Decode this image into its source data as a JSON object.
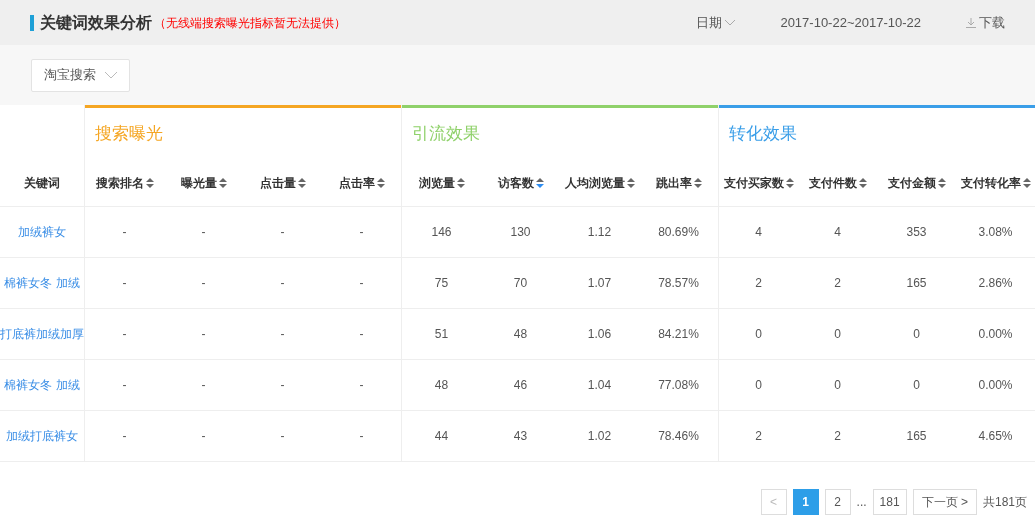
{
  "header": {
    "title": "关键词效果分析",
    "note": "（无线端搜索曝光指标暂无法提供）",
    "date_label": "日期",
    "date_range": "2017-10-22~2017-10-22",
    "download": "下载"
  },
  "source_select": {
    "value": "淘宝搜索"
  },
  "table": {
    "keyword_column": "关键词",
    "groups": [
      {
        "title": "搜索曝光",
        "color": "#f5a623",
        "columns": [
          {
            "label": "搜索排名",
            "sorted": false
          },
          {
            "label": "曝光量",
            "sorted": false
          },
          {
            "label": "点击量",
            "sorted": false
          },
          {
            "label": "点击率",
            "sorted": false
          }
        ]
      },
      {
        "title": "引流效果",
        "color": "#8fd16a",
        "columns": [
          {
            "label": "浏览量",
            "sorted": false
          },
          {
            "label": "访客数",
            "sorted": true
          },
          {
            "label": "人均浏览量",
            "sorted": false
          },
          {
            "label": "跳出率",
            "sorted": false
          }
        ]
      },
      {
        "title": "转化效果",
        "color": "#3a9ee8",
        "columns": [
          {
            "label": "支付买家数",
            "sorted": false
          },
          {
            "label": "支付件数",
            "sorted": false
          },
          {
            "label": "支付金额",
            "sorted": false
          },
          {
            "label": "支付转化率",
            "sorted": false
          }
        ]
      }
    ],
    "rows": [
      {
        "keyword": "加绒裤女",
        "cells": [
          "-",
          "-",
          "-",
          "-",
          "146",
          "130",
          "1.12",
          "80.69%",
          "4",
          "4",
          "353",
          "3.08%"
        ]
      },
      {
        "keyword": "棉裤女冬 加绒",
        "cells": [
          "-",
          "-",
          "-",
          "-",
          "75",
          "70",
          "1.07",
          "78.57%",
          "2",
          "2",
          "165",
          "2.86%"
        ]
      },
      {
        "keyword": "打底裤加绒加厚",
        "cells": [
          "-",
          "-",
          "-",
          "-",
          "51",
          "48",
          "1.06",
          "84.21%",
          "0",
          "0",
          "0",
          "0.00%"
        ]
      },
      {
        "keyword": "棉裤女冬 加绒",
        "cells": [
          "-",
          "-",
          "-",
          "-",
          "48",
          "46",
          "1.04",
          "77.08%",
          "0",
          "0",
          "0",
          "0.00%"
        ]
      },
      {
        "keyword": "加绒打底裤女",
        "cells": [
          "-",
          "-",
          "-",
          "-",
          "44",
          "43",
          "1.02",
          "78.46%",
          "2",
          "2",
          "165",
          "4.65%"
        ]
      }
    ]
  },
  "pagination": {
    "prev": "<",
    "pages": [
      {
        "label": "1",
        "selected": true
      },
      {
        "label": "2",
        "selected": false
      }
    ],
    "ellipsis": "...",
    "last": "181",
    "next": "下一页 >",
    "total": "共181页"
  }
}
